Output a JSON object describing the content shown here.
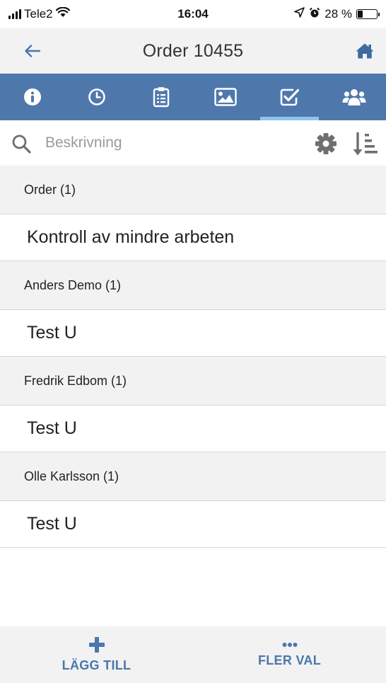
{
  "status_bar": {
    "carrier": "Tele2",
    "time": "16:04",
    "battery_text": "28 %",
    "battery_level": 0.28,
    "icons": [
      "signal-icon",
      "wifi-icon",
      "location-arrow-icon",
      "alarm-icon",
      "battery-icon"
    ]
  },
  "header": {
    "title": "Order 10455",
    "back_icon": "arrow-left-icon",
    "home_icon": "home-icon"
  },
  "tabs": [
    {
      "icon": "info-icon",
      "active": false
    },
    {
      "icon": "clock-icon",
      "active": false
    },
    {
      "icon": "clipboard-icon",
      "active": false
    },
    {
      "icon": "image-icon",
      "active": false
    },
    {
      "icon": "checkbox-icon",
      "active": true
    },
    {
      "icon": "users-icon",
      "active": false
    }
  ],
  "search": {
    "placeholder": "Beskrivning",
    "value": ""
  },
  "groups": [
    {
      "header": "Order (1)",
      "item": "Kontroll av mindre arbeten"
    },
    {
      "header": "Anders Demo (1)",
      "item": "Test U"
    },
    {
      "header": "Fredrik Edbom (1)",
      "item": "Test U"
    },
    {
      "header": "Olle Karlsson (1)",
      "item": "Test U"
    }
  ],
  "bottom_bar": {
    "add_label": "LÄGG TILL",
    "more_label": "FLER VAL"
  },
  "colors": {
    "accent": "#4e78ac",
    "tab_indicator": "#8ec3f2",
    "header_bg": "#f2f2f2",
    "icon_gray": "#6f6f6f"
  }
}
